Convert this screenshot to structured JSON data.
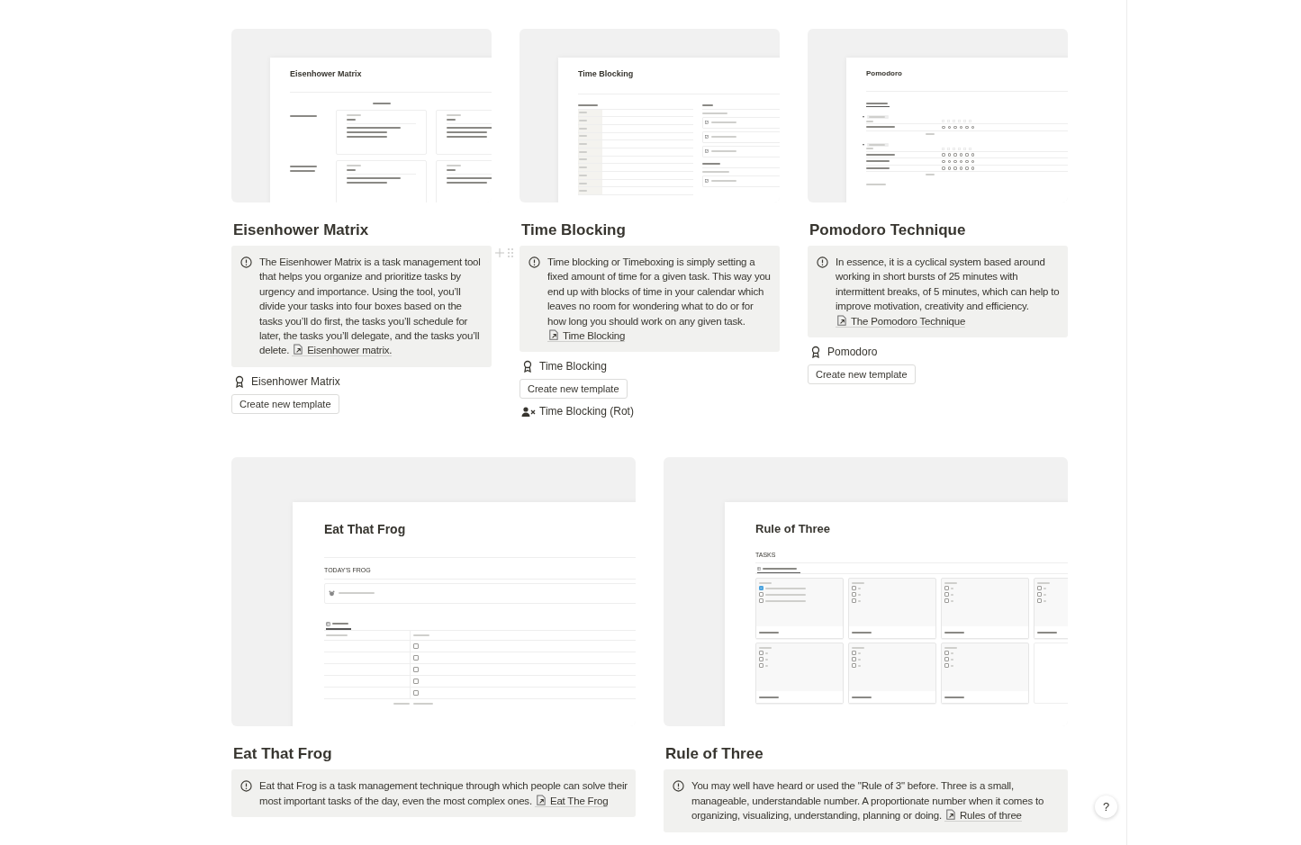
{
  "templates": [
    {
      "title": "Eisenhower Matrix",
      "preview": {
        "kind": "matrix",
        "title": "Eisenhower Matrix"
      },
      "callout": {
        "text": "The Eisenhower Matrix is a task management tool that helps you organize and prioritize tasks by urgency and importance. Using the tool, you’ll divide your tasks into four boxes based on the tasks you’ll do first, the tasks you’ll schedule for later, the tasks you’ll delegate, and the tasks you’ll delete.",
        "link": "Eisenhower matrix."
      },
      "items": [
        {
          "kind": "template-link",
          "label": "Eisenhower Matrix"
        },
        {
          "kind": "button",
          "label": "Create new template"
        }
      ]
    },
    {
      "title": "Time Blocking",
      "preview": {
        "kind": "timeblock",
        "title": "Time Blocking"
      },
      "callout": {
        "text": "Time blocking or Timeboxing is simply setting a fixed amount of time for a given task. This way you end up with blocks of time in your calendar which leaves no room for wondering what to do or for how long you should work on any given task.",
        "link": "Time Blocking"
      },
      "items": [
        {
          "kind": "template-link",
          "label": "Time Blocking"
        },
        {
          "kind": "button",
          "label": "Create new template"
        },
        {
          "kind": "user-link",
          "label": "Time Blocking (Rot)"
        }
      ]
    },
    {
      "title": "Pomodoro Technique",
      "preview": {
        "kind": "pomodoro",
        "title": "Pomodoro",
        "groups": [
          {
            "rows": [
              {
                "checks": [
                  false,
                  false,
                  false,
                  false,
                  false,
                  false
                ]
              }
            ]
          },
          {
            "rows": [
              {
                "checks": [
                  false,
                  false,
                  false,
                  false,
                  false,
                  false
                ]
              },
              {
                "checks": [
                  false,
                  false,
                  false,
                  false,
                  false,
                  false
                ]
              },
              {
                "checks": [
                  false,
                  false,
                  false,
                  false,
                  false,
                  false
                ]
              }
            ]
          }
        ]
      },
      "callout": {
        "text": "In essence, it is a cyclical system based around working in short bursts of 25 minutes with intermittent breaks, of 5 minutes, which can help to improve motivation, creativity and efficiency.",
        "link": "The Pomodoro Technique"
      },
      "items": [
        {
          "kind": "template-link",
          "label": "Pomodoro"
        },
        {
          "kind": "button",
          "label": "Create new template"
        }
      ]
    },
    {
      "title": "Eat That Frog",
      "preview": {
        "kind": "frog",
        "title": "Eat That Frog",
        "section": "TODAY'S FROG",
        "rows": [
          {
            "done": false
          },
          {
            "done": false
          },
          {
            "done": false
          },
          {
            "done": false
          },
          {
            "done": false
          }
        ]
      },
      "callout": {
        "text": "Eat that Frog is a task management technique through which people can solve their most important tasks of the day, even the most complex ones.",
        "link": "Eat The Frog"
      }
    },
    {
      "title": "Rule of Three",
      "preview": {
        "kind": "rule3",
        "title": "Rule of Three",
        "section": "TASKS",
        "cards": [
          {
            "tasks": [
              {
                "checked": true
              },
              {
                "checked": false
              },
              {
                "checked": false
              }
            ]
          },
          {
            "tasks": [
              {
                "checked": false
              },
              {
                "checked": false
              },
              {
                "checked": false
              }
            ]
          },
          {
            "tasks": [
              {
                "checked": false
              },
              {
                "checked": false
              },
              {
                "checked": false
              }
            ]
          },
          {
            "tasks": [
              {
                "checked": false
              },
              {
                "checked": false
              },
              {
                "checked": false
              }
            ]
          },
          {
            "tasks": [
              {
                "checked": false
              },
              {
                "checked": false
              },
              {
                "checked": false
              }
            ]
          },
          {
            "tasks": [
              {
                "checked": false
              },
              {
                "checked": false
              },
              {
                "checked": false
              }
            ]
          },
          {
            "tasks": [
              {
                "checked": false
              },
              {
                "checked": false
              },
              {
                "checked": false
              }
            ]
          }
        ]
      },
      "callout": {
        "text": "You may well have heard or used the \"Rule of 3\" before. Three is a small, manageable, understandable number. A proportionate number when it comes to organizing, visualizing, understanding, planning or doing.",
        "link": "Rules of three"
      }
    }
  ],
  "help_button": "?"
}
